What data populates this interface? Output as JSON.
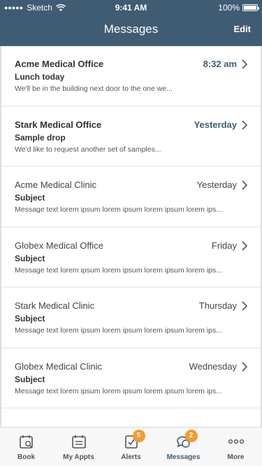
{
  "status_bar": {
    "carrier": "Sketch",
    "time": "9:41 AM",
    "battery": "100%"
  },
  "nav": {
    "title": "Messages",
    "edit_label": "Edit"
  },
  "messages": [
    {
      "sender": "Acme Medical Office",
      "time": "8:32 am",
      "subject": "Lunch today",
      "preview": "We'll be in the building next door to the one we...",
      "unread": true
    },
    {
      "sender": "Stark Medical Office",
      "time": "Yesterday",
      "subject": "Sample drop",
      "preview": "We'd like to request another set of samples...",
      "unread": true
    },
    {
      "sender": "Acme Medical Clinic",
      "time": "Yesterday",
      "subject": "Subject",
      "preview": "Message text lorem ipsum lorem ipsum lorem ipsum lorem ips...",
      "unread": false
    },
    {
      "sender": "Globex Medical Office",
      "time": "Friday",
      "subject": "Subject",
      "preview": "Message text lorem ipsum lorem ipsum lorem ipsum lorem ips...",
      "unread": false
    },
    {
      "sender": "Stark Medical Clinic",
      "time": "Thursday",
      "subject": "Subject",
      "preview": "Message text lorem ipsum lorem ipsum lorem ipsum lorem ips...",
      "unread": false
    },
    {
      "sender": "Globex Medical Clinic",
      "time": "Wednesday",
      "subject": "Subject",
      "preview": "Message text lorem ipsum lorem ipsum lorem ipsum lorem ips...",
      "unread": false
    }
  ],
  "tabs": [
    {
      "label": "Book",
      "icon": "calendar-icon",
      "badge": "",
      "active": false
    },
    {
      "label": "My Appts",
      "icon": "calendar-list-icon",
      "badge": "",
      "active": false
    },
    {
      "label": "Alerts",
      "icon": "checklist-icon",
      "badge": "5",
      "active": false
    },
    {
      "label": "Messages",
      "icon": "chat-bubbles-icon",
      "badge": "2",
      "active": true
    },
    {
      "label": "More",
      "icon": "more-dots-icon",
      "badge": "",
      "active": false
    }
  ],
  "colors": {
    "header": "#3f5c73",
    "badge": "#f39a2d",
    "unread_time": "#3f5c73"
  }
}
